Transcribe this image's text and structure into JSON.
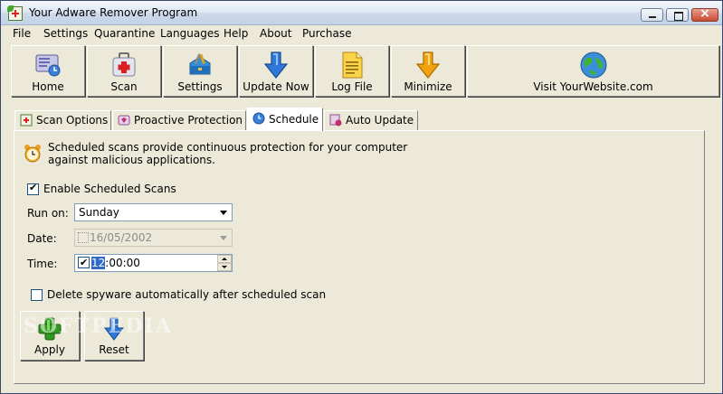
{
  "window": {
    "title": "Your Adware Remover Program"
  },
  "menu": {
    "items": [
      "File",
      "Settings",
      "Quarantine",
      "Languages",
      "Help",
      "About",
      "Purchase"
    ]
  },
  "toolbar": {
    "home": "Home",
    "scan": "Scan",
    "settings": "Settings",
    "update": "Update Now",
    "logfile": "Log File",
    "minimize": "Minimize",
    "website": "Visit YourWebsite.com"
  },
  "tabs": {
    "scan_options": "Scan Options",
    "proactive": "Proactive Protection",
    "schedule": "Schedule",
    "auto_update": "Auto Update"
  },
  "schedule": {
    "info_line1": "Scheduled scans provide continuous protection for your computer",
    "info_line2": "against malicious applications.",
    "enable_label": "Enable Scheduled Scans",
    "enable_checked": true,
    "run_on_label": "Run on:",
    "run_on_value": "Sunday",
    "date_label": "Date:",
    "date_value": "16/05/2002",
    "time_label": "Time:",
    "time_hour": "12",
    "time_rest": ":00:00",
    "delete_label": "Delete spyware automatically after scheduled scan",
    "delete_checked": false
  },
  "buttons": {
    "apply": "Apply",
    "reset": "Reset"
  },
  "watermark": "SOFTPEDIA",
  "colors": {
    "face": "#ece9d8",
    "selection": "#3169c6",
    "green_icon": "#2f9a1f",
    "blue_arrow": "#2f78d8",
    "orange_arrow": "#f2a20e"
  }
}
